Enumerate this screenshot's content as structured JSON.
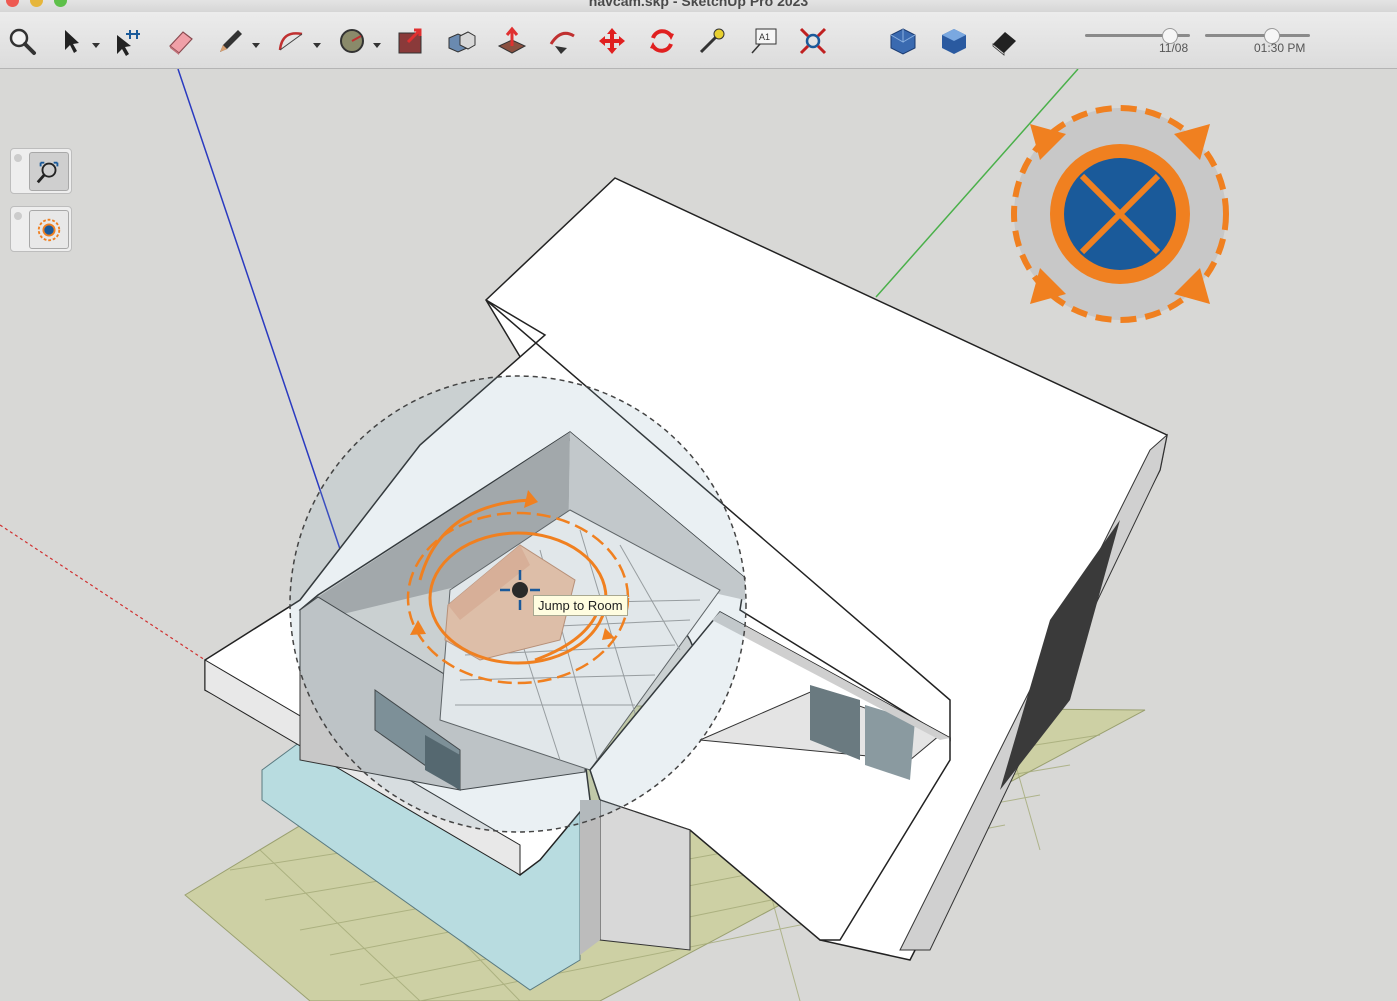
{
  "window": {
    "title": "navcam.skp - SketchUp Pro 2023"
  },
  "toolbar": {
    "tools": [
      {
        "name": "zoom-icon"
      },
      {
        "name": "select-icon"
      },
      {
        "name": "multi-select-icon"
      },
      {
        "name": "eraser-icon"
      },
      {
        "name": "pencil-icon"
      },
      {
        "name": "arc-icon"
      },
      {
        "name": "circle-icon"
      },
      {
        "name": "push-pull-box-icon"
      },
      {
        "name": "components-icon"
      },
      {
        "name": "push-pull-icon"
      },
      {
        "name": "follow-me-icon"
      },
      {
        "name": "move-icon"
      },
      {
        "name": "rotate-icon"
      },
      {
        "name": "tape-measure-icon"
      },
      {
        "name": "text-icon"
      },
      {
        "name": "zoom-extents-icon"
      },
      {
        "name": "box-view-icon"
      },
      {
        "name": "iso-view-icon"
      },
      {
        "name": "eraser-view-icon"
      }
    ],
    "text_tool_glyph": "A1",
    "shadow_date": "11/08",
    "shadow_time": "01:30 PM"
  },
  "viewport": {
    "tooltip": "Jump to Room"
  },
  "colors": {
    "accent_orange": "#f08020",
    "nav_blue": "#1a5a9a",
    "axis_blue": "#2a3ac0",
    "axis_green": "#4ab04a",
    "axis_red": "#d03030"
  }
}
